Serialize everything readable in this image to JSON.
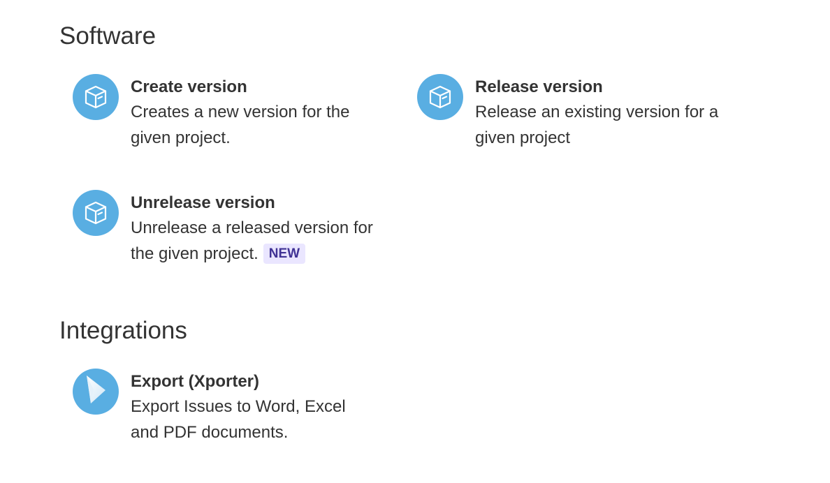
{
  "sections": {
    "software": {
      "title": "Software",
      "items": [
        {
          "icon": "package-box-icon",
          "title": "Create version",
          "desc_lines": [
            "Creates a new version for the",
            "given project."
          ]
        },
        {
          "icon": "package-box-icon",
          "title": "Release version",
          "desc_lines": [
            "Release an existing version for a",
            "given project"
          ]
        },
        {
          "icon": "package-box-icon",
          "title": "Unrelease version",
          "desc_lines": [
            "Unrelease a released version for",
            "the given project."
          ],
          "badge": "NEW"
        }
      ]
    },
    "integrations": {
      "title": "Integrations",
      "items": [
        {
          "icon": "xporter-arrow-icon",
          "title": "Export (Xporter)",
          "desc_lines": [
            "Export Issues to Word, Excel",
            "and PDF documents."
          ]
        }
      ]
    }
  },
  "colors": {
    "icon_bg": "#59aee2",
    "text": "#333333",
    "badge_text": "#403294",
    "badge_bg": "#eae6ff"
  }
}
